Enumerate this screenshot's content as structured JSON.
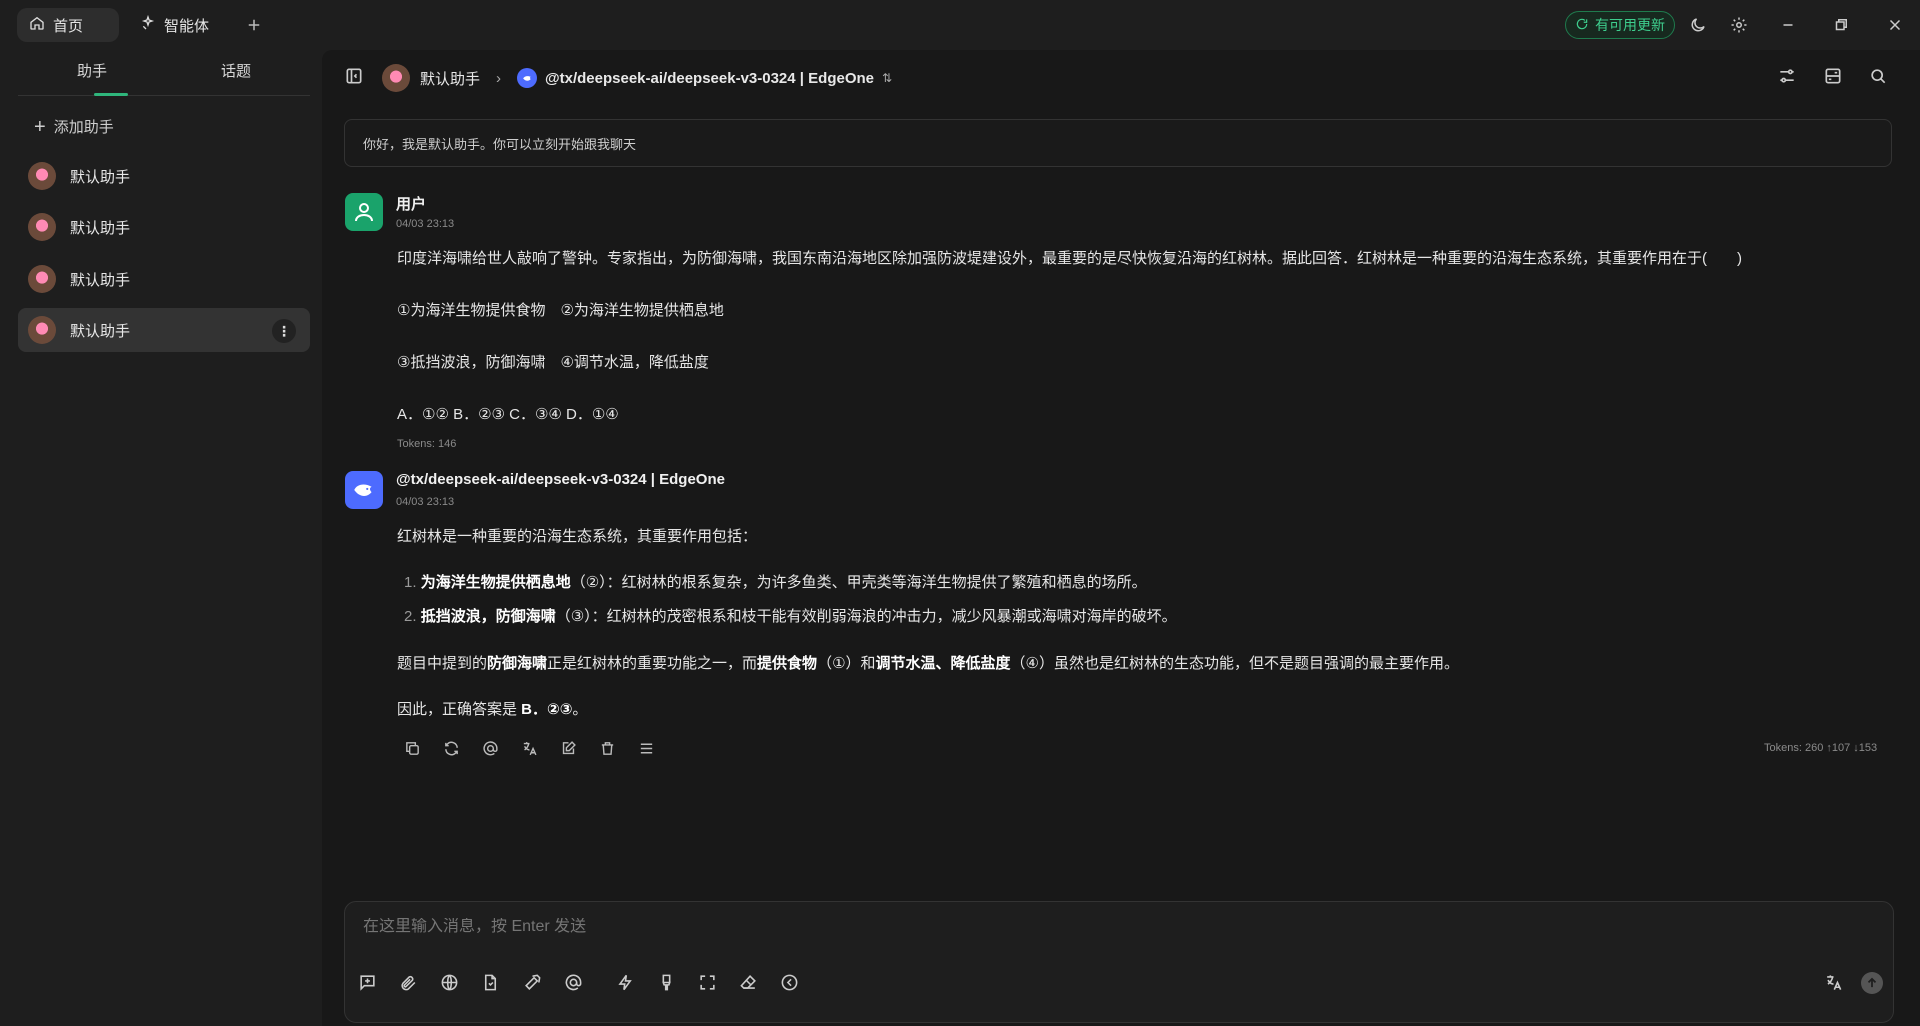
{
  "titlebar": {
    "tabs": [
      {
        "label": "首页",
        "icon": "home-icon"
      },
      {
        "label": "智能体",
        "icon": "sparkle-icon"
      }
    ],
    "add_tab_icon": "plus-icon",
    "update_label": "有可用更新",
    "right_icons": [
      "moon-icon",
      "gear-icon",
      "minimize-icon",
      "restore-icon",
      "close-icon"
    ]
  },
  "sidebar": {
    "tabs": [
      "助手",
      "话题"
    ],
    "active_tab": "助手",
    "add_label": "添加助手",
    "items": [
      {
        "label": "默认助手"
      },
      {
        "label": "默认助手"
      },
      {
        "label": "默认助手"
      },
      {
        "label": "默认助手"
      }
    ],
    "active_index": 3
  },
  "header": {
    "assistant_name": "默认助手",
    "model_name": "@tx/deepseek-ai/deepseek-v3-0324 | EdgeOne",
    "icons": [
      "sidebar-toggle-icon",
      "settings-sliders-icon",
      "layout-icon",
      "search-icon"
    ]
  },
  "welcome": "你好，我是默认助手。你可以立刻开始跟我聊天",
  "messages": {
    "user": {
      "name": "用户",
      "time": "04/03 23:13",
      "lines": [
        "印度洋海啸给世人敲响了警钟。专家指出，为防御海啸，我国东南沿海地区除加强防波堤建设外，最重要的是尽快恢复沿海的红树林。据此回答．红树林是一种重要的沿海生态系统，其重要作用在于(　　)",
        "①为海洋生物提供食物　②为海洋生物提供栖息地",
        "③抵挡波浪，防御海啸　④调节水温，降低盐度",
        "A．①②  B．②③  C．③④  D．①④"
      ],
      "tokens": "Tokens: 146"
    },
    "assistant": {
      "name": "@tx/deepseek-ai/deepseek-v3-0324 | EdgeOne",
      "time": "04/03 23:13",
      "intro": "红树林是一种重要的沿海生态系统，其重要作用包括：",
      "list": [
        {
          "num": "1.",
          "bold": "为海洋生物提供栖息地",
          "rest": "（②）：红树林的根系复杂，为许多鱼类、甲壳类等海洋生物提供了繁殖和栖息的场所。"
        },
        {
          "num": "2.",
          "bold": "抵挡波浪，防御海啸",
          "rest": "（③）：红树林的茂密根系和枝干能有效削弱海浪的冲击力，减少风暴潮或海啸对海岸的破坏。"
        }
      ],
      "para": {
        "a": "题目中提到的",
        "b1": "防御海啸",
        "c": "正是红树林的重要功能之一，而",
        "b2": "提供食物",
        "d": "（①）和",
        "b3": "调节水温、降低盐度",
        "e": "（④）虽然也是红树林的生态功能，但不是题目强调的最主要作用。"
      },
      "conclusion_prefix": "因此，正确答案是 ",
      "conclusion_answer": "B．②③",
      "conclusion_suffix": "。",
      "tokens": "Tokens: 260 ↑107 ↓153",
      "actions": [
        "copy-icon",
        "refresh-icon",
        "at-icon",
        "translate-icon",
        "edit-icon",
        "trash-icon",
        "menu-icon"
      ]
    }
  },
  "input": {
    "placeholder": "在这里输入消息，按 Enter 发送",
    "tools": [
      "new-topic-icon",
      "paperclip-icon",
      "globe-icon",
      "file-icon",
      "hammer-icon",
      "at-icon",
      "lightning-icon",
      "brush-icon",
      "fullscreen-icon",
      "eraser-icon",
      "chevron-left-circle-icon"
    ],
    "right_icons": [
      "translate-icon",
      "send-icon"
    ]
  },
  "colors": {
    "accent": "#2fb67c",
    "update": "#3ecf8e",
    "user_avatar": "#1aa36b",
    "model_avatar": "#4d6bfe"
  }
}
